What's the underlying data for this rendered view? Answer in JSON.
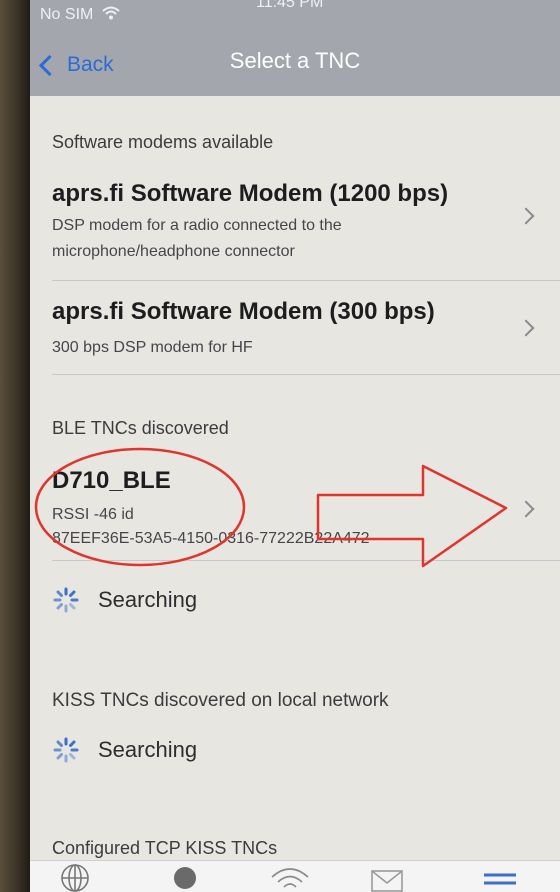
{
  "status": {
    "carrier": "No SIM",
    "time": "11:45 PM"
  },
  "nav": {
    "back_label": "Back",
    "title": "Select a TNC"
  },
  "sections": {
    "software": {
      "header": "Software modems available",
      "items": [
        {
          "title": "aprs.fi Software Modem (1200 bps)",
          "sub1": "DSP modem for a radio connected to the",
          "sub2": "microphone/headphone connector"
        },
        {
          "title": "aprs.fi Software Modem (300 bps)",
          "sub1": "300 bps DSP modem for HF"
        }
      ]
    },
    "ble": {
      "header": "BLE TNCs discovered",
      "device": {
        "name": "D710_BLE",
        "rssi": "RSSI -46 id",
        "id": "87EEF36E-53A5-4150-0316-77222B22A472"
      },
      "searching": "Searching"
    },
    "kiss": {
      "header": "KISS TNCs discovered on local network",
      "searching": "Searching"
    },
    "tcp": {
      "header": "Configured TCP KISS TNCs"
    }
  },
  "annotation_colors": {
    "marker": "#e0342c"
  },
  "tabbar_icons": [
    "globe-icon",
    "search-icon",
    "wifi-icon",
    "mail-icon",
    "menu-icon"
  ]
}
